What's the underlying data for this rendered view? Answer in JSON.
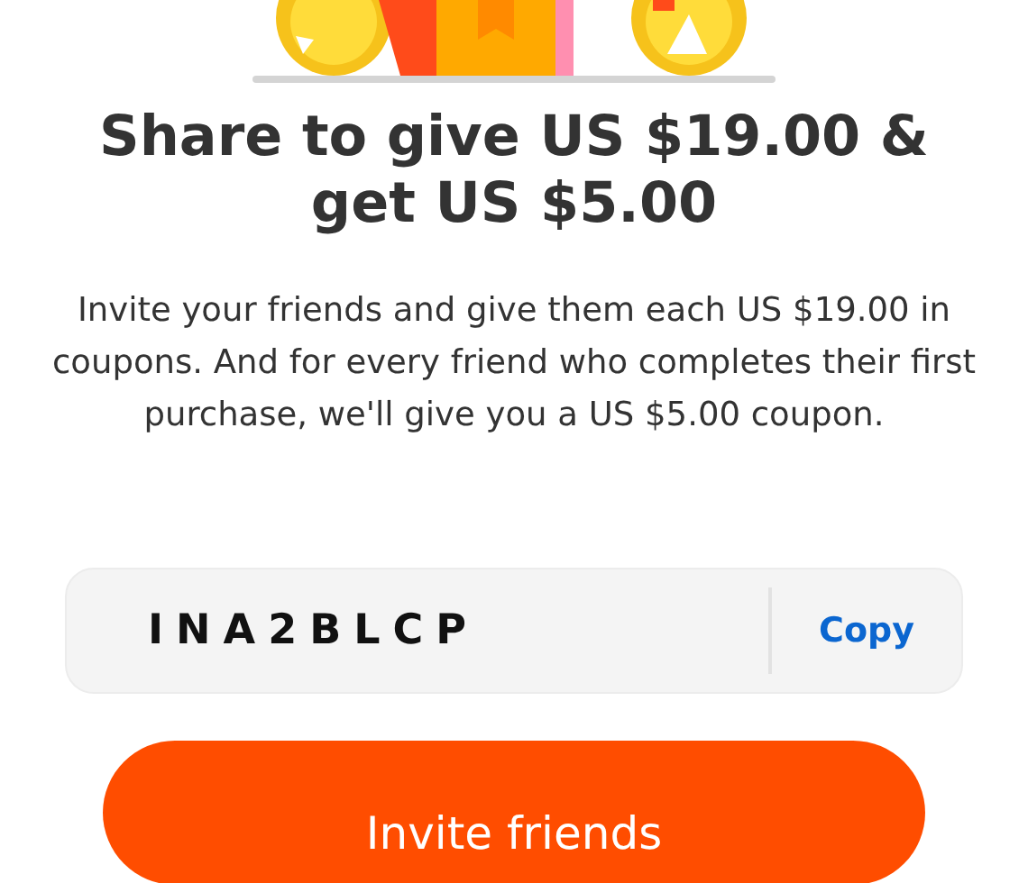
{
  "title": "Share to give US $19.00 & get US $5.00",
  "description": "Invite your friends and give them each US $19.00 in coupons. And for every friend who completes their first purchase, we'll give you a US $5.00 coupon.",
  "code_box": {
    "code": "INA2BLCP",
    "action": "Copy"
  },
  "primary_button": "Invite friends"
}
